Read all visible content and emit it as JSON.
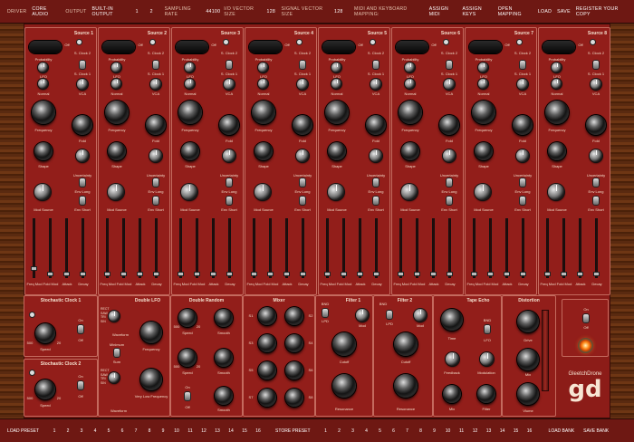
{
  "topbar": {
    "driver_label": "Driver",
    "driver_value": "Core Audio",
    "output_label": "Output",
    "output_value": "Built-in Output",
    "ch1": "1",
    "ch2": "2",
    "sr_label": "Sampling Rate",
    "sr_value": "44100",
    "io_label": "I/O Vector Size",
    "io_value": "128",
    "sig_label": "Signal Vector Size",
    "sig_value": "128",
    "midi_label": "MIDI and Keyboard Mapping:",
    "assign_midi": "Assign MIDI",
    "assign_keys": "Assign Keys",
    "open_mapping": "Open Mapping",
    "load": "Load",
    "save": "Save",
    "register": "Register Your Copy"
  },
  "sources": [
    {
      "title": "Source 1"
    },
    {
      "title": "Source 2"
    },
    {
      "title": "Source 3"
    },
    {
      "title": "Source 4"
    },
    {
      "title": "Source 5"
    },
    {
      "title": "Source 6"
    },
    {
      "title": "Source 7"
    },
    {
      "title": "Source 8"
    }
  ],
  "src_labels": {
    "off": "Off",
    "probability": "Probability",
    "sclock2": "S. Clock 2",
    "lfo": "LFO",
    "sclock1": "S. Clock 1",
    "normal": "Normal",
    "vca": "VCA",
    "frequency": "Frequency",
    "fold": "Fold",
    "shape": "Shape",
    "uncertainty": "Uncertainty",
    "env_long": "Env Long",
    "mod_source": "Mod Source",
    "env_short": "Env Short",
    "freq_mod": "Freq Mod",
    "fold_mod": "Fold Mod",
    "attack": "Attack",
    "decay": "Decay"
  },
  "sc1": {
    "title": "Stochastic Clock 1",
    "speed": "Speed",
    "on": "On",
    "off": "Off",
    "v500": "500",
    "v20": "20"
  },
  "sc2": {
    "title": "Stochastic Clock 2",
    "speed": "Speed",
    "on": "On",
    "off": "Off",
    "v500": "500",
    "v20": "20"
  },
  "dlfo": {
    "title": "Double LFO",
    "waveform": "Waveform",
    "minimum": "Minimum",
    "sum": "Sum",
    "frequency": "Frequency",
    "vlf": "Very Low Frequency",
    "waves": "RECT SAW TRI SIN"
  },
  "drand": {
    "title": "Double Random",
    "speed": "Speed",
    "smooth": "Smooth",
    "on": "On",
    "off": "Off",
    "v500": "500",
    "v20": "20"
  },
  "mixer": {
    "title": "Mixer",
    "channels": [
      "S1",
      "S2",
      "S3",
      "S4",
      "S5",
      "S6",
      "S7",
      "S8"
    ]
  },
  "filter1": {
    "title": "Filter 1",
    "bnd": "BND",
    "lpd": "LPD",
    "mod": "Mod",
    "cutoff": "Cutoff",
    "resonance": "Resonance"
  },
  "filter2": {
    "title": "Filter 2",
    "bnd": "BND",
    "lpd": "LPD",
    "mod": "Mod",
    "cutoff": "Cutoff",
    "resonance": "Resonance"
  },
  "tape": {
    "title": "Tape Echo",
    "time": "Time",
    "bnd": "BND",
    "lfo": "LFO",
    "feedback": "Feedback",
    "modulation": "Modulation",
    "mix": "Mix",
    "filter": "Filter"
  },
  "dist": {
    "title": "Distortion",
    "drive": "Drive",
    "mix": "Mix",
    "volume": "Vlume",
    "on": "On",
    "off": "Off"
  },
  "brand": {
    "name": "GleetchDrone",
    "logo": "gd"
  },
  "bottombar": {
    "load_preset": "Load Preset",
    "store_preset": "Store Preset",
    "numbers": [
      "1",
      "2",
      "3",
      "4",
      "5",
      "6",
      "7",
      "8",
      "9",
      "10",
      "11",
      "12",
      "13",
      "14",
      "15",
      "16"
    ],
    "load_bank": "Load Bank",
    "save_bank": "Save Bank"
  }
}
